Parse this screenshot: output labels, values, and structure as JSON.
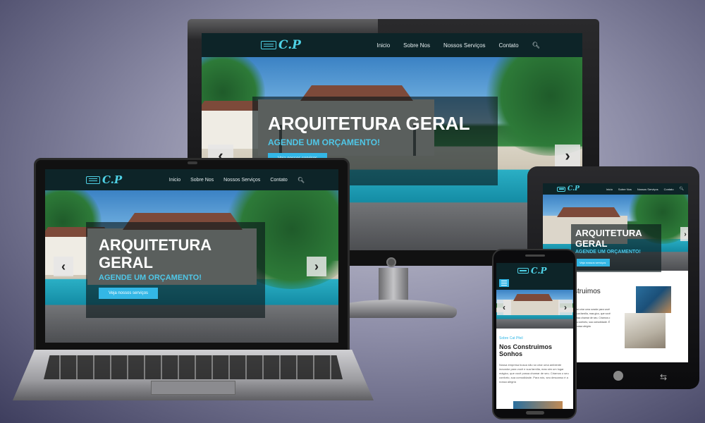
{
  "site": {
    "logo_text": "C.P",
    "nav": [
      "Inicio",
      "Sobre Nos",
      "Nossos Serviços",
      "Contato"
    ],
    "hero_title": "ARQUITETURA GERAL",
    "hero_title_line1": "ARQUITETURA",
    "hero_title_line2": "GERAL",
    "hero_subtitle": "AGENDE UM ORÇAMENTO!",
    "cta_label": "Veja nossos serviços",
    "prev_arrow": "‹",
    "next_arrow": "›"
  },
  "about": {
    "kicker": "Sobre Cat Pfeil",
    "title": "Nos Construimos Sonhos",
    "title_partial": "struimos",
    "body": "Nossa empresa busca não só criar uma ambiente inovador para você e sua família, mas sim um lugar mágico, que você possa chamar de seu. Criamos o seu conforto, sua comodidade. Para nós, seu descanso é a nossa alegria",
    "body_partial": "lo só criar uma ovador para você e sua família, mas gico, que você possa chamar de seu. Criamos o seu conforto, sua comodidade. É a nossa alegria"
  },
  "colors": {
    "accent": "#4fc7e8",
    "nav_bg": "#0d2428",
    "cta": "#33b7e6"
  },
  "icons": {
    "search": "search-icon",
    "menu": "hamburger-menu-icon"
  }
}
